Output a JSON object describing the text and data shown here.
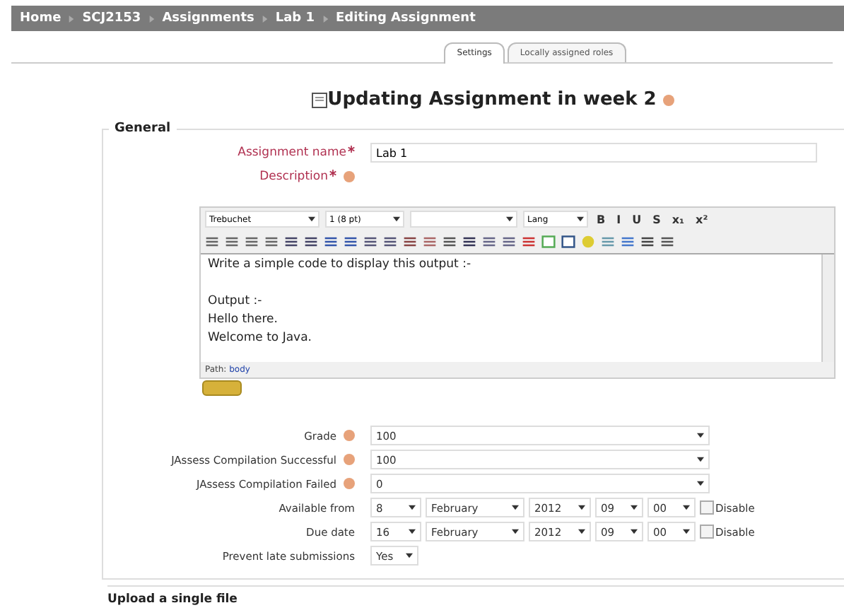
{
  "breadcrumb": [
    "Home",
    "SCJ2153",
    "Assignments",
    "Lab 1",
    "Editing Assignment"
  ],
  "tabs": [
    {
      "label": "Settings",
      "selected": true
    },
    {
      "label": "Locally assigned roles",
      "selected": false
    }
  ],
  "heading": "Updating Assignment in week 2",
  "general": {
    "legend": "General",
    "name": {
      "label": "Assignment name",
      "required": true,
      "value": "Lab 1"
    },
    "description": {
      "label": "Description",
      "required": true,
      "toolbar_selects": [
        "Trebuchet",
        "1 (8 pt)",
        "Lang"
      ],
      "toolbar_glyphs": [
        "B",
        "I",
        "U",
        "S",
        "x₁",
        "x²"
      ],
      "paragraphs": [
        [
          "Write a simple code to display this output :-"
        ],
        [
          "Output :-",
          "Hello there.",
          "Welcome to Java."
        ]
      ],
      "path_label": "Path:",
      "path_value": "body"
    },
    "selects": [
      {
        "label": "Grade",
        "value": "100"
      },
      {
        "label": "JAssess Compilation Successful",
        "value": "100"
      },
      {
        "label": "JAssess Compilation Failed",
        "value": "0"
      }
    ],
    "dates": [
      {
        "label": "Available from",
        "day": "8",
        "month": "February",
        "year": "2012",
        "hour": "09",
        "minute": "00",
        "disable_label": "Disable",
        "disabled": false
      },
      {
        "label": "Due date",
        "day": "16",
        "month": "February",
        "year": "2012",
        "hour": "09",
        "minute": "00",
        "disable_label": "Disable",
        "disabled": false
      }
    ],
    "late": {
      "label": "Prevent late submissions",
      "value": "Yes"
    }
  },
  "next_section": "Upload a single file"
}
